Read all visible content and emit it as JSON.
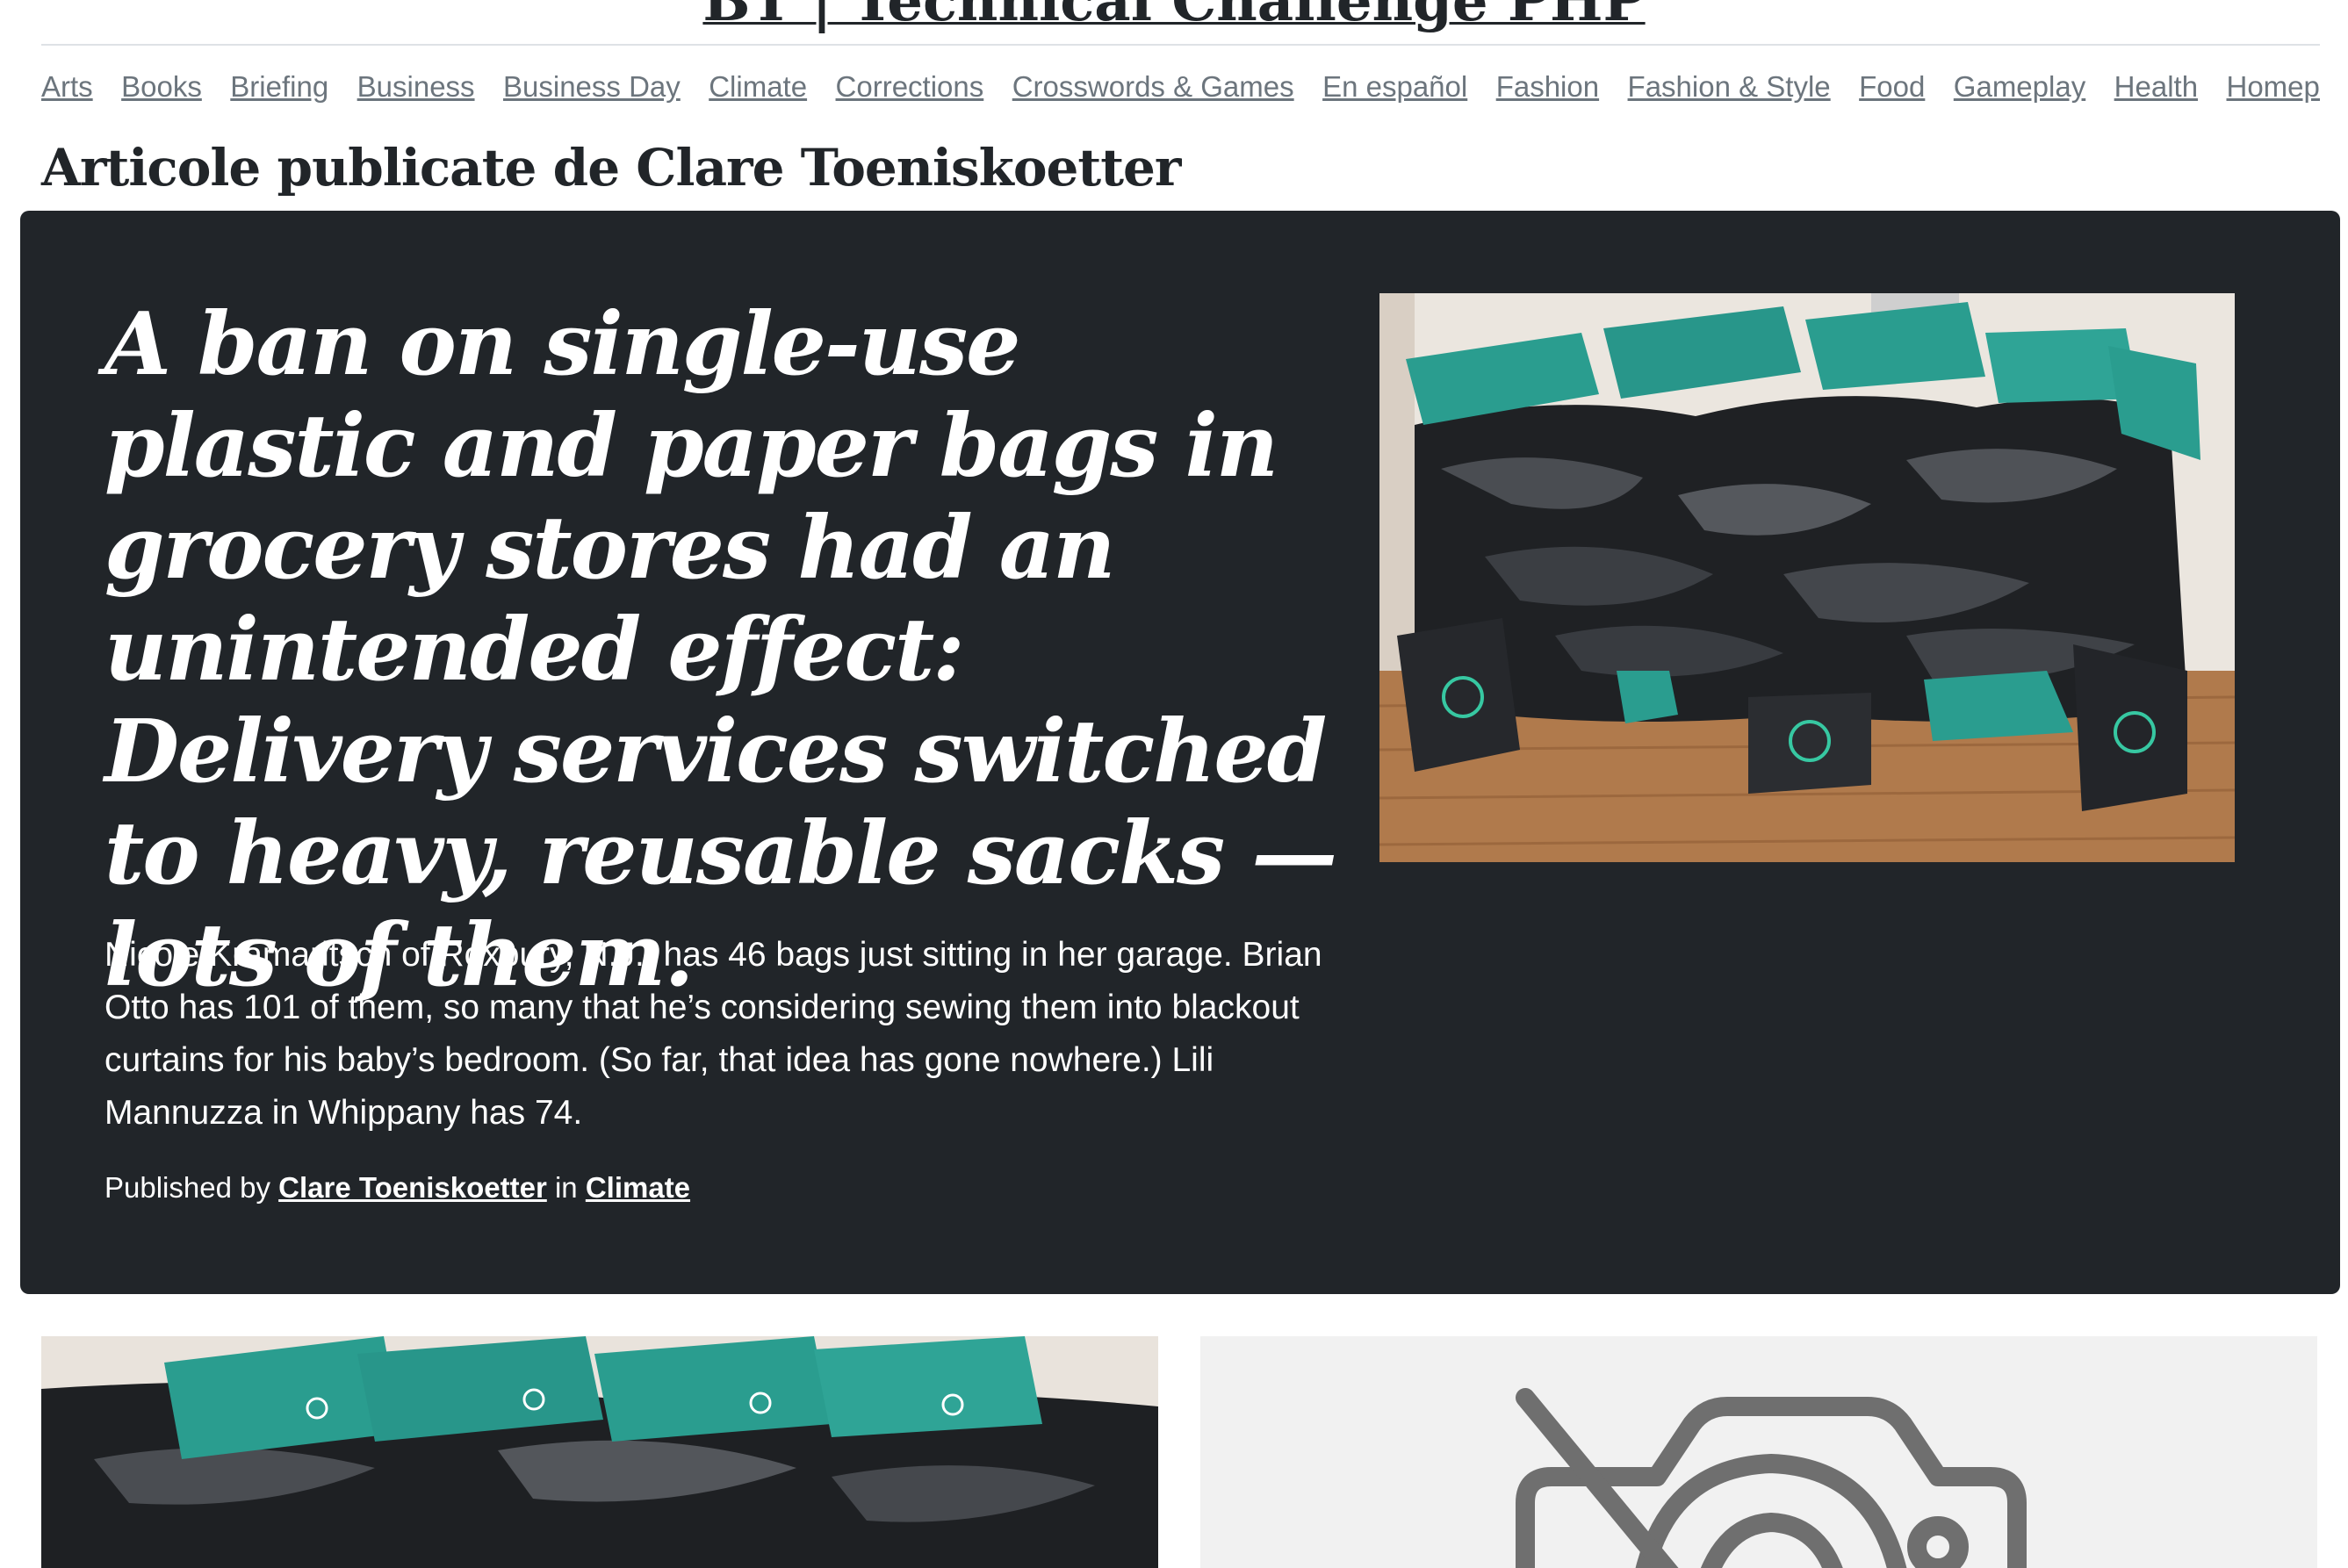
{
  "site": {
    "title": "BT | Technical Challenge PHP"
  },
  "nav": {
    "items": [
      "Arts",
      "Books",
      "Briefing",
      "Business",
      "Business Day",
      "Climate",
      "Corrections",
      "Crosswords & Games",
      "En español",
      "Fashion",
      "Fashion & Style",
      "Food",
      "Gameplay",
      "Health",
      "Homepage"
    ]
  },
  "page": {
    "heading": "Articole publicate de Clare Toeniskoetter"
  },
  "featured": {
    "headline": "A ban on single-use plastic and paper bags in grocery stores had an unintended effect: Delivery services switched to heavy, reusable sacks — lots of them.",
    "excerpt": "Nicole Kramaritsch of Roxbury, N.J., has 46 bags just sitting in her garage. Brian Otto has 101 of them, so many that he’s considering sewing them into blackout curtains for his baby’s bedroom. (So far, that idea has gone nowhere.) Lili Mannuzza in Whippany has 74.",
    "published_by_label": "Published by",
    "author": "Clare Toeniskoetter",
    "in_label": "in",
    "section": "Climate",
    "image_icon": "photo-of-reusable-grocery-bags"
  },
  "cards": [
    {
      "image_icon": "photo-of-reusable-grocery-bags"
    },
    {
      "image_icon": "image-unavailable-icon"
    }
  ],
  "colors": {
    "hero_background": "#212529",
    "nav_link": "#6c757d",
    "bag_teal": "#2a9d8f",
    "bag_black": "#1d1f22",
    "placeholder_icon": "#6f6f6f"
  }
}
